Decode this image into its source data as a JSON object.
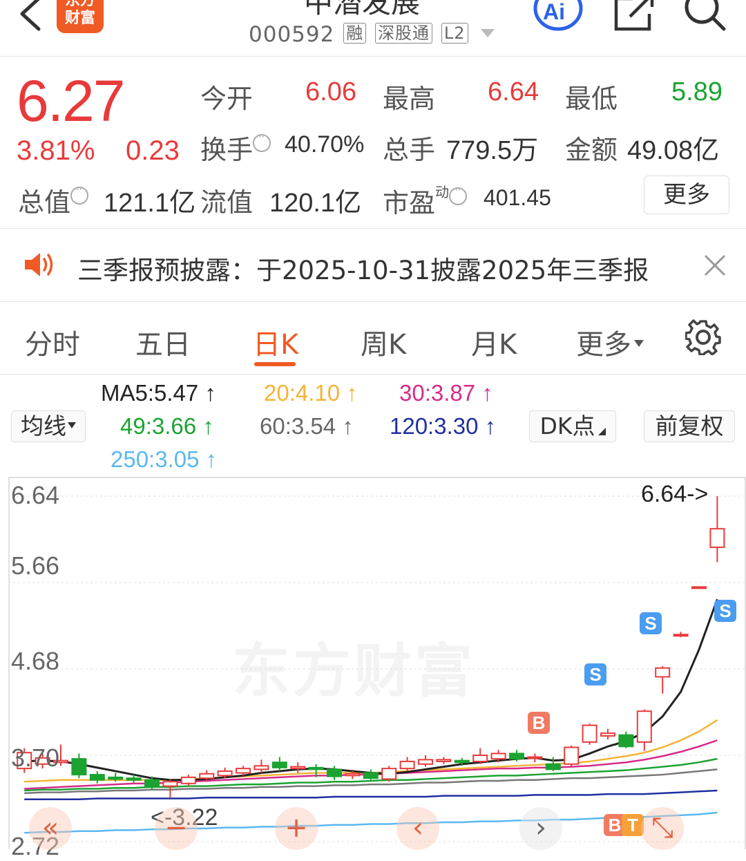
{
  "header": {
    "logo_line1": "东方",
    "logo_line2": "财富",
    "title": "中潜发展",
    "code": "000592",
    "tags": [
      "融",
      "深股通",
      "L2"
    ]
  },
  "quote": {
    "price": "6.27",
    "change_pct": "3.81%",
    "change": "0.23",
    "open_label": "今开",
    "open": "6.06",
    "high_label": "最高",
    "high": "6.64",
    "low_label": "最低",
    "low": "5.89",
    "turnover_label": "换手",
    "turnover": "40.70%",
    "volume_label": "总手",
    "volume": "779.5万",
    "amount_label": "金额",
    "amount": "49.08亿",
    "mktcap_label": "总值",
    "mktcap": "121.1亿",
    "float_label": "流值",
    "float": "120.1亿",
    "pe_label": "市盈",
    "pe_sup": "动",
    "pe": "401.45",
    "more_label": "更多"
  },
  "notice": {
    "text": "三季报预披露：于2025-10-31披露2025年三季报"
  },
  "tabs": {
    "items": [
      "分时",
      "五日",
      "日K",
      "周K",
      "月K",
      "更多"
    ],
    "active": "日K"
  },
  "indicators": {
    "ma_select": "均线",
    "ma5": "MA5:5.47 ↑",
    "ma20": "20:4.10 ↑",
    "ma30": "30:3.87 ↑",
    "ma49": "49:3.66 ↑",
    "ma60": "60:3.54 ↑",
    "ma120": "120:3.30 ↑",
    "ma250": "250:3.05 ↑",
    "dk_label": "DK点",
    "adjust_label": "前复权",
    "colors": {
      "ma5": "#222222",
      "ma20": "#f5b335",
      "ma30": "#d62a8a",
      "ma49": "#1aa330",
      "ma60": "#777777",
      "ma120": "#1f2f9e",
      "ma250": "#5ab8f0"
    }
  },
  "chart_data": {
    "type": "candlestick",
    "y_ticks": [
      "6.64",
      "5.66",
      "4.68",
      "3.70",
      "2.72"
    ],
    "ylim": [
      2.72,
      6.64
    ],
    "high_label": "6.64->",
    "low_label": "<-3.22",
    "watermark": "东方财富",
    "marks": [
      "S",
      "S",
      "S",
      "B",
      "B",
      "T"
    ],
    "candles": [
      {
        "o": 3.55,
        "c": 3.73,
        "h": 3.78,
        "l": 3.5
      },
      {
        "o": 3.6,
        "c": 3.67,
        "h": 3.72,
        "l": 3.55
      },
      {
        "o": 3.62,
        "c": 3.64,
        "h": 3.82,
        "l": 3.58
      },
      {
        "o": 3.66,
        "c": 3.48,
        "h": 3.72,
        "l": 3.44
      },
      {
        "o": 3.48,
        "c": 3.42,
        "h": 3.52,
        "l": 3.38
      },
      {
        "o": 3.45,
        "c": 3.43,
        "h": 3.5,
        "l": 3.4
      },
      {
        "o": 3.44,
        "c": 3.42,
        "h": 3.48,
        "l": 3.39
      },
      {
        "o": 3.42,
        "c": 3.35,
        "h": 3.46,
        "l": 3.3
      },
      {
        "o": 3.35,
        "c": 3.4,
        "h": 3.43,
        "l": 3.22
      },
      {
        "o": 3.38,
        "c": 3.45,
        "h": 3.48,
        "l": 3.35
      },
      {
        "o": 3.44,
        "c": 3.49,
        "h": 3.53,
        "l": 3.4
      },
      {
        "o": 3.47,
        "c": 3.52,
        "h": 3.56,
        "l": 3.44
      },
      {
        "o": 3.5,
        "c": 3.55,
        "h": 3.58,
        "l": 3.47
      },
      {
        "o": 3.54,
        "c": 3.58,
        "h": 3.65,
        "l": 3.5
      },
      {
        "o": 3.62,
        "c": 3.56,
        "h": 3.68,
        "l": 3.52
      },
      {
        "o": 3.55,
        "c": 3.57,
        "h": 3.62,
        "l": 3.5
      },
      {
        "o": 3.56,
        "c": 3.54,
        "h": 3.6,
        "l": 3.45
      },
      {
        "o": 3.54,
        "c": 3.46,
        "h": 3.58,
        "l": 3.42
      },
      {
        "o": 3.47,
        "c": 3.49,
        "h": 3.52,
        "l": 3.43
      },
      {
        "o": 3.5,
        "c": 3.44,
        "h": 3.54,
        "l": 3.42
      },
      {
        "o": 3.43,
        "c": 3.55,
        "h": 3.58,
        "l": 3.4
      },
      {
        "o": 3.55,
        "c": 3.63,
        "h": 3.68,
        "l": 3.52
      },
      {
        "o": 3.6,
        "c": 3.65,
        "h": 3.7,
        "l": 3.57
      },
      {
        "o": 3.63,
        "c": 3.65,
        "h": 3.68,
        "l": 3.6
      },
      {
        "o": 3.64,
        "c": 3.62,
        "h": 3.67,
        "l": 3.58
      },
      {
        "o": 3.63,
        "c": 3.7,
        "h": 3.78,
        "l": 3.6
      },
      {
        "o": 3.66,
        "c": 3.72,
        "h": 3.76,
        "l": 3.62
      },
      {
        "o": 3.72,
        "c": 3.66,
        "h": 3.76,
        "l": 3.63
      },
      {
        "o": 3.68,
        "c": 3.68,
        "h": 3.72,
        "l": 3.62
      },
      {
        "o": 3.6,
        "c": 3.54,
        "h": 3.68,
        "l": 3.52
      },
      {
        "o": 3.6,
        "c": 3.79,
        "h": 3.81,
        "l": 3.58
      },
      {
        "o": 3.85,
        "c": 4.04,
        "h": 4.06,
        "l": 3.82
      },
      {
        "o": 3.92,
        "c": 3.95,
        "h": 4.0,
        "l": 3.88
      },
      {
        "o": 3.93,
        "c": 3.8,
        "h": 3.97,
        "l": 3.78
      },
      {
        "o": 3.85,
        "c": 4.2,
        "h": 4.22,
        "l": 3.75
      },
      {
        "o": 4.59,
        "c": 4.69,
        "h": 4.71,
        "l": 4.4
      },
      {
        "o": 5.07,
        "c": 5.07,
        "h": 5.1,
        "l": 5.04
      },
      {
        "o": 5.61,
        "c": 5.61,
        "h": 5.61,
        "l": 5.61
      },
      {
        "o": 6.06,
        "c": 6.27,
        "h": 6.64,
        "l": 5.89
      }
    ],
    "ma5": [
      3.63,
      3.64,
      3.63,
      3.6,
      3.56,
      3.52,
      3.48,
      3.44,
      3.42,
      3.42,
      3.43,
      3.45,
      3.47,
      3.5,
      3.52,
      3.54,
      3.55,
      3.54,
      3.52,
      3.5,
      3.49,
      3.51,
      3.54,
      3.57,
      3.6,
      3.62,
      3.64,
      3.66,
      3.67,
      3.64,
      3.65,
      3.72,
      3.8,
      3.86,
      3.96,
      4.14,
      4.42,
      4.9,
      5.47
    ],
    "ma20": [
      3.4,
      3.41,
      3.42,
      3.42,
      3.42,
      3.42,
      3.42,
      3.42,
      3.42,
      3.43,
      3.44,
      3.45,
      3.46,
      3.47,
      3.48,
      3.49,
      3.5,
      3.5,
      3.5,
      3.5,
      3.51,
      3.52,
      3.53,
      3.54,
      3.55,
      3.56,
      3.57,
      3.58,
      3.59,
      3.6,
      3.61,
      3.63,
      3.66,
      3.69,
      3.73,
      3.79,
      3.87,
      3.97,
      4.1
    ],
    "ma30": [
      3.32,
      3.33,
      3.34,
      3.35,
      3.36,
      3.37,
      3.38,
      3.38,
      3.39,
      3.4,
      3.41,
      3.42,
      3.43,
      3.44,
      3.45,
      3.46,
      3.47,
      3.47,
      3.48,
      3.48,
      3.49,
      3.5,
      3.51,
      3.52,
      3.53,
      3.54,
      3.55,
      3.55,
      3.56,
      3.56,
      3.57,
      3.58,
      3.6,
      3.62,
      3.65,
      3.69,
      3.74,
      3.8,
      3.87
    ],
    "ma49": [
      3.3,
      3.31,
      3.31,
      3.32,
      3.32,
      3.33,
      3.33,
      3.34,
      3.34,
      3.35,
      3.35,
      3.36,
      3.37,
      3.37,
      3.38,
      3.39,
      3.39,
      3.4,
      3.4,
      3.41,
      3.42,
      3.42,
      3.43,
      3.44,
      3.45,
      3.46,
      3.47,
      3.47,
      3.48,
      3.49,
      3.5,
      3.51,
      3.52,
      3.53,
      3.55,
      3.57,
      3.59,
      3.62,
      3.66
    ],
    "ma60": [
      3.27,
      3.28,
      3.28,
      3.29,
      3.29,
      3.3,
      3.3,
      3.31,
      3.31,
      3.32,
      3.32,
      3.33,
      3.33,
      3.34,
      3.34,
      3.35,
      3.35,
      3.36,
      3.36,
      3.37,
      3.37,
      3.38,
      3.39,
      3.39,
      3.4,
      3.41,
      3.41,
      3.42,
      3.42,
      3.43,
      3.44,
      3.44,
      3.45,
      3.46,
      3.47,
      3.48,
      3.5,
      3.52,
      3.54
    ],
    "ma120": [
      3.2,
      3.2,
      3.2,
      3.2,
      3.21,
      3.21,
      3.21,
      3.21,
      3.21,
      3.21,
      3.22,
      3.22,
      3.22,
      3.22,
      3.22,
      3.22,
      3.22,
      3.23,
      3.23,
      3.23,
      3.23,
      3.23,
      3.23,
      3.24,
      3.24,
      3.24,
      3.24,
      3.24,
      3.25,
      3.25,
      3.25,
      3.25,
      3.26,
      3.26,
      3.26,
      3.27,
      3.28,
      3.29,
      3.3
    ],
    "ma250": [
      2.82,
      2.83,
      2.83,
      2.84,
      2.84,
      2.85,
      2.85,
      2.86,
      2.86,
      2.87,
      2.87,
      2.88,
      2.88,
      2.89,
      2.89,
      2.9,
      2.9,
      2.91,
      2.91,
      2.92,
      2.92,
      2.93,
      2.93,
      2.94,
      2.94,
      2.95,
      2.95,
      2.96,
      2.96,
      2.97,
      2.97,
      2.98,
      2.99,
      2.99,
      3.0,
      3.01,
      3.02,
      3.03,
      3.05
    ]
  }
}
